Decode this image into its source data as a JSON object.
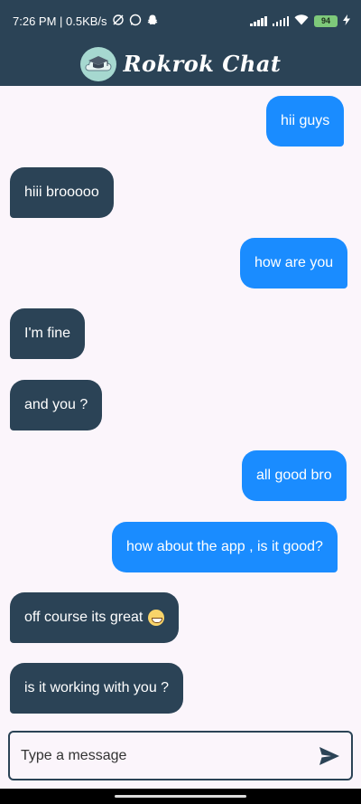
{
  "status_bar": {
    "time_speed": "7:26 PM | 0.5KB/s",
    "battery": "94"
  },
  "app": {
    "title": "Rokrok Chat",
    "logo_icon": "graduation-cap-cloud-icon"
  },
  "messages": [
    {
      "text": "hii guys",
      "direction": "sent"
    },
    {
      "text": "hiii brooooo",
      "direction": "received"
    },
    {
      "text": "how are you",
      "direction": "sent"
    },
    {
      "text": "I'm fine",
      "direction": "received"
    },
    {
      "text": "and you ?",
      "direction": "received"
    },
    {
      "text": "all good bro",
      "direction": "sent"
    },
    {
      "text": "how about the app , is it good?",
      "direction": "sent"
    },
    {
      "text": "off course its great",
      "direction": "received",
      "emoji": "grinning-face"
    },
    {
      "text": "is it working with you ?",
      "direction": "received"
    }
  ],
  "composer": {
    "placeholder": "Type a message",
    "send_icon": "send-icon"
  },
  "colors": {
    "header": "#2b4356",
    "sent_bubble": "#1a8cff",
    "received_bubble": "#2b4356",
    "background": "#fbf5fb"
  }
}
